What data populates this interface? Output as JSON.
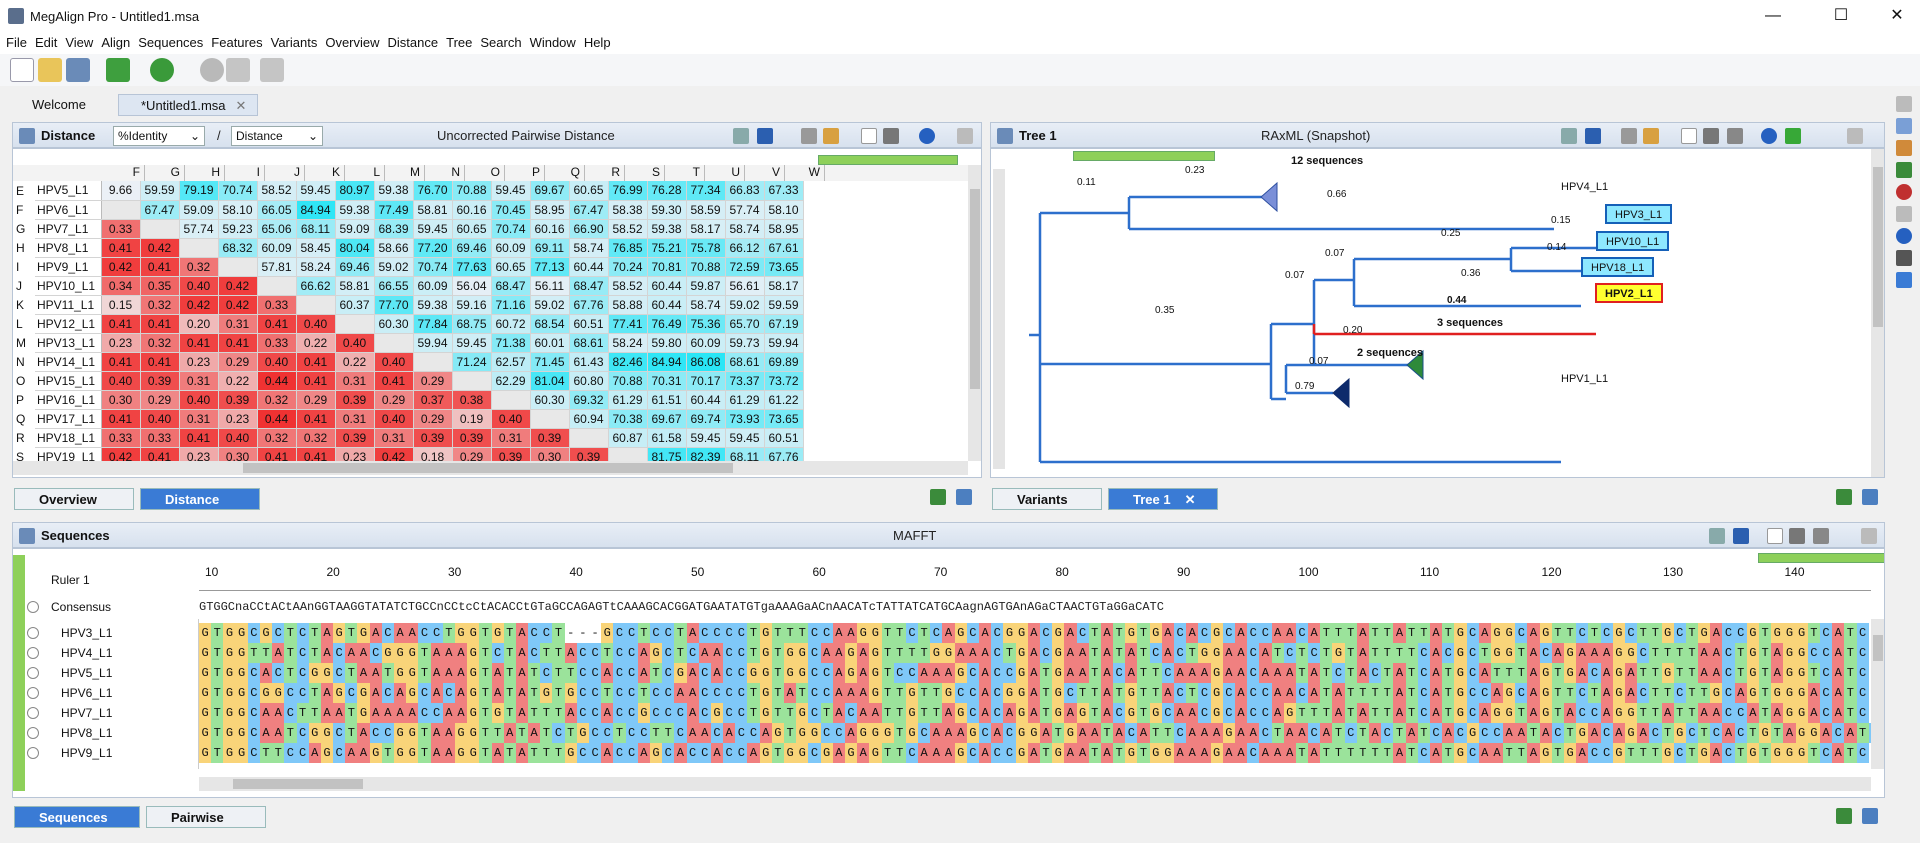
{
  "window": {
    "title": "MegAlign Pro - Untitled1.msa",
    "min": "—",
    "max": "☐",
    "close": "✕"
  },
  "menu": [
    "File",
    "Edit",
    "View",
    "Align",
    "Sequences",
    "Features",
    "Variants",
    "Overview",
    "Distance",
    "Tree",
    "Search",
    "Window",
    "Help"
  ],
  "tabs": [
    {
      "label": "Welcome"
    },
    {
      "label": "*Untitled1.msa"
    }
  ],
  "distance": {
    "panel_name": "Distance",
    "metric": "%Identity",
    "slash": "/",
    "mode": "Distance",
    "center_title": "Uncorrected Pairwise Distance",
    "columns": [
      "F",
      "G",
      "H",
      "I",
      "J",
      "K",
      "L",
      "M",
      "N",
      "O",
      "P",
      "Q",
      "R",
      "S",
      "T",
      "U",
      "V",
      "W"
    ],
    "rows": [
      {
        "l": "E",
        "n": "HPV5_L1",
        "v": [
          "9.66",
          "59.59",
          "79.19",
          "70.74",
          "58.52",
          "59.45",
          "80.97",
          "59.38",
          "76.70",
          "70.88",
          "59.45",
          "69.67",
          "60.65",
          "76.99",
          "76.28",
          "77.34",
          "66.83",
          "67.33"
        ]
      },
      {
        "l": "F",
        "n": "HPV6_L1",
        "v": [
          "",
          "67.47",
          "59.09",
          "58.10",
          "66.05",
          "84.94",
          "59.38",
          "77.49",
          "58.81",
          "60.16",
          "70.45",
          "58.95",
          "67.47",
          "58.38",
          "59.30",
          "58.59",
          "57.74",
          "58.10"
        ]
      },
      {
        "l": "G",
        "n": "HPV7_L1",
        "v": [
          "0.33",
          "",
          "57.74",
          "59.23",
          "65.06",
          "68.11",
          "59.09",
          "68.39",
          "59.45",
          "60.65",
          "70.74",
          "60.16",
          "66.90",
          "58.52",
          "59.38",
          "58.17",
          "58.74",
          "58.95"
        ]
      },
      {
        "l": "H",
        "n": "HPV8_L1",
        "v": [
          "0.41",
          "0.42",
          "",
          "68.32",
          "60.09",
          "58.45",
          "80.04",
          "58.66",
          "77.20",
          "69.46",
          "60.09",
          "69.11",
          "58.74",
          "76.85",
          "75.21",
          "75.78",
          "66.12",
          "67.61"
        ]
      },
      {
        "l": "I",
        "n": "HPV9_L1",
        "v": [
          "0.42",
          "0.41",
          "0.32",
          "",
          "57.81",
          "58.24",
          "69.46",
          "59.02",
          "70.74",
          "77.63",
          "60.65",
          "77.13",
          "60.44",
          "70.24",
          "70.81",
          "70.88",
          "72.59",
          "73.65"
        ]
      },
      {
        "l": "J",
        "n": "HPV10_L1",
        "v": [
          "0.34",
          "0.35",
          "0.40",
          "0.42",
          "",
          "66.62",
          "58.81",
          "66.55",
          "60.09",
          "56.04",
          "68.47",
          "56.11",
          "68.47",
          "58.52",
          "60.44",
          "59.87",
          "56.61",
          "58.17"
        ]
      },
      {
        "l": "K",
        "n": "HPV11_L1",
        "v": [
          "0.15",
          "0.32",
          "0.42",
          "0.42",
          "0.33",
          "",
          "60.37",
          "77.70",
          "59.38",
          "59.16",
          "71.16",
          "59.02",
          "67.76",
          "58.88",
          "60.44",
          "58.74",
          "59.02",
          "59.59"
        ]
      },
      {
        "l": "L",
        "n": "HPV12_L1",
        "v": [
          "0.41",
          "0.41",
          "0.20",
          "0.31",
          "0.41",
          "0.40",
          "",
          "60.30",
          "77.84",
          "68.75",
          "60.72",
          "68.54",
          "60.51",
          "77.41",
          "76.49",
          "75.36",
          "65.70",
          "67.19"
        ]
      },
      {
        "l": "M",
        "n": "HPV13_L1",
        "v": [
          "0.23",
          "0.32",
          "0.41",
          "0.41",
          "0.33",
          "0.22",
          "0.40",
          "",
          "59.94",
          "59.45",
          "71.38",
          "60.01",
          "68.61",
          "58.24",
          "59.80",
          "60.09",
          "59.73",
          "59.94"
        ]
      },
      {
        "l": "N",
        "n": "HPV14_L1",
        "v": [
          "0.41",
          "0.41",
          "0.23",
          "0.29",
          "0.40",
          "0.41",
          "0.22",
          "0.40",
          "",
          "71.24",
          "62.57",
          "71.45",
          "61.43",
          "82.46",
          "84.94",
          "86.08",
          "68.61",
          "69.89"
        ]
      },
      {
        "l": "O",
        "n": "HPV15_L1",
        "v": [
          "0.40",
          "0.39",
          "0.31",
          "0.22",
          "0.44",
          "0.41",
          "0.31",
          "0.41",
          "0.29",
          "",
          "62.29",
          "81.04",
          "60.80",
          "70.88",
          "70.31",
          "70.17",
          "73.37",
          "73.72"
        ]
      },
      {
        "l": "P",
        "n": "HPV16_L1",
        "v": [
          "0.30",
          "0.29",
          "0.40",
          "0.39",
          "0.32",
          "0.29",
          "0.39",
          "0.29",
          "0.37",
          "0.38",
          "",
          "60.30",
          "69.32",
          "61.29",
          "61.51",
          "60.44",
          "61.29",
          "61.22"
        ]
      },
      {
        "l": "Q",
        "n": "HPV17_L1",
        "v": [
          "0.41",
          "0.40",
          "0.31",
          "0.23",
          "0.44",
          "0.41",
          "0.31",
          "0.40",
          "0.29",
          "0.19",
          "0.40",
          "",
          "60.94",
          "70.38",
          "69.67",
          "69.74",
          "73.93",
          "73.65"
        ]
      },
      {
        "l": "R",
        "n": "HPV18_L1",
        "v": [
          "0.33",
          "0.33",
          "0.41",
          "0.40",
          "0.32",
          "0.32",
          "0.39",
          "0.31",
          "0.39",
          "0.39",
          "0.31",
          "0.39",
          "",
          "60.87",
          "61.58",
          "59.45",
          "59.45",
          "60.51"
        ]
      },
      {
        "l": "S",
        "n": "HPV19_L1",
        "v": [
          "0.42",
          "0.41",
          "0.23",
          "0.30",
          "0.41",
          "0.41",
          "0.23",
          "0.42",
          "0.18",
          "0.29",
          "0.39",
          "0.30",
          "0.39",
          "",
          "81.75",
          "82.39",
          "68.11",
          "67.76"
        ]
      }
    ],
    "tab_overview": "Overview",
    "tab_distance": "Distance"
  },
  "tree": {
    "panel_name": "Tree 1",
    "center_title": "RAxML (Snapshot)",
    "collapsed": [
      {
        "label": "12 sequences"
      },
      {
        "label": "3 sequences"
      },
      {
        "label": "2 sequences"
      }
    ],
    "leaves": [
      "HPV4_L1",
      "HPV3_L1",
      "HPV10_L1",
      "HPV18_L1",
      "HPV2_L1",
      "HPV1_L1"
    ],
    "branch_labels": [
      "0.11",
      "0.23",
      "0.66",
      "0.15",
      "0.25",
      "0.14",
      "0.07",
      "0.36",
      "0.07",
      "0.44",
      "0.35",
      "0.20",
      "0.07",
      "0.79"
    ],
    "tab_variants": "Variants",
    "tab_tree": "Tree 1",
    "tab_close": "✕"
  },
  "sequences": {
    "panel_name": "Sequences",
    "center_title": "MAFFT",
    "ruler_label": "Ruler 1",
    "consensus_label": "Consensus",
    "ruler_ticks": [
      "10",
      "20",
      "30",
      "40",
      "50",
      "60",
      "70",
      "80",
      "90",
      "100",
      "110",
      "120",
      "130",
      "140"
    ],
    "consensus": "GTGGCnaCCtACtAAnGGTAAGGTATATCTGCCnCCtcCtACACCtGTaGCCAGAGTtCAAAGCACGGATGAATATGTgaAAAGaACnAACATcTATTATCATGCAagnAGTGAnAGaCTAACTGTaGGaCATC",
    "rows": [
      {
        "name": "HPV3_L1",
        "seq": "GTGGCGCTCTAGTGACAACCTGGTGTACCT---GCCTCCTACCCCTGTTTCCAAGGTTCTCAGCACGGACGACTATGTGACACGCACCAACATTTATTATTATGCAGGCAGTTCTCGCTTGCTGACCGTGGGTCATC"
      },
      {
        "name": "HPV4_L1",
        "seq": "GTGGTTATCTACAACGGGTAAAGTCTACTTACCTCCAGCTCAACCTGTGGCAAGAGTTTTGGAAACTGACGAATATATCACTGGAACATCTCTGTATTTTCACGCTGGTACAGAAAGGCTTTTAACTGTAGGCCATC"
      },
      {
        "name": "HPV5_L1",
        "seq": "GTGGCACTCGGCTAATGGTAAAGTATATCTTCCACCATCGACACCGGTGGCCAGAGTCCAAAGCACCGATGAATACATTCAAAGAACAAATATCTACTATCATGCATTTAGTGACAGATTGTTAACTGTAGGTCATC"
      },
      {
        "name": "HPV6_L1",
        "seq": "GTGGCGGCCTAGCGACAGCACAGTATATGTGCCTCCTCCAACCCCTGTATCCAAAGTTGTTGCCACGGATGCTTATGTTACTCGCACCAACATATTTTATCATGCCAGCAGTTCTAGACTTCTTGCAGTGGGACATC"
      },
      {
        "name": "HPV7_L1",
        "seq": "GTGGCAACTTAATGAAAACCAAGTGTATTTACCACCGCCCACGCCTGTTGCTACAATTGTTAGCACAGATGAGTACGTGCAACGCACCAGTTTATATTATCATGCAGGTAGTACCAGGTTATTAACCATAGGACATC"
      },
      {
        "name": "HPV8_L1",
        "seq": "GTGGCAATCGGCTACCGGTAAGGTTATATCTGCCTCCTTCAACACCAGTGGCCAGGGTGCAAAGCACGGATGAATACATTCAAAGAACTAACATCTACTATCACGCCAATACTGACAGACTGCTCACTGTAGGACATC"
      },
      {
        "name": "HPV9_L1",
        "seq": "GTGGCTTCCAGCAAGTGGTAAGGTATATTTGCCACCAGCACCACCAGTGGCGAGAGTTCAAAGCACCGATGAATATGTGGAAAGAACAAATATTTTTTATCATGCAATTAGTGACCGTTTGCTGACTGTGGGTCATC"
      }
    ],
    "tab_sequences": "Sequences",
    "tab_pairwise": "Pairwise"
  }
}
